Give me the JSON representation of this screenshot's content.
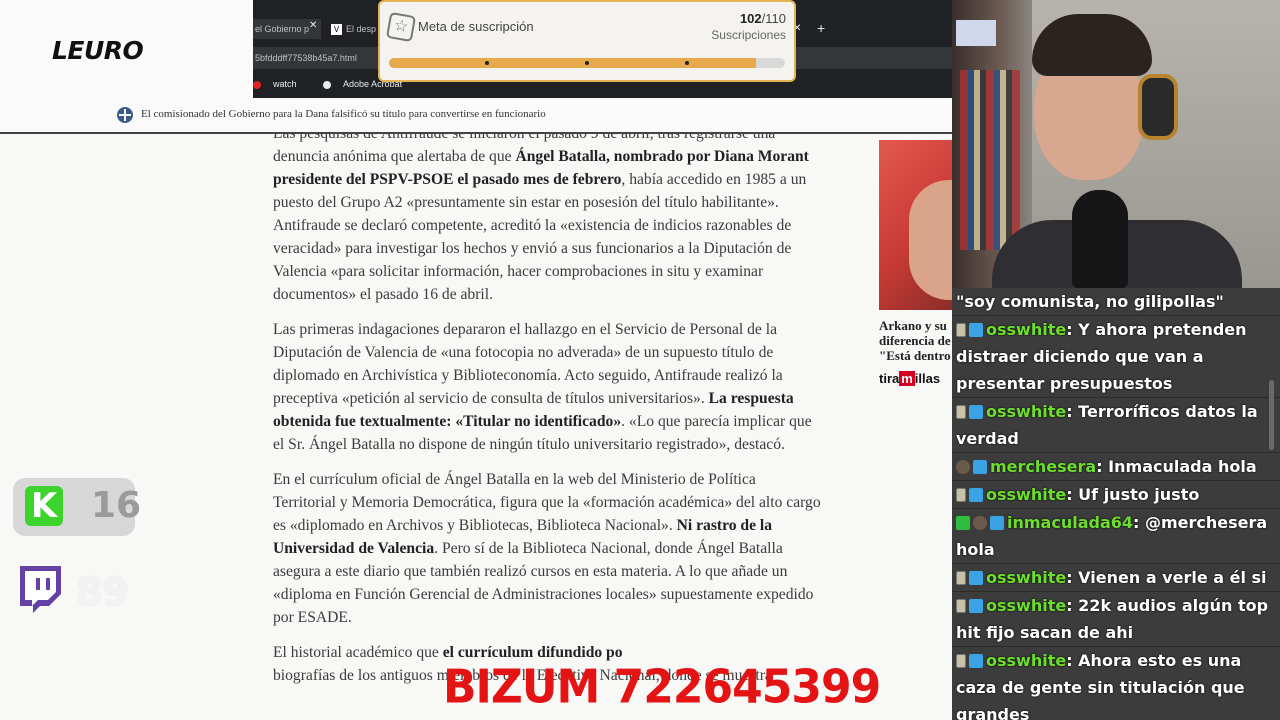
{
  "header": {
    "logo": "LEURO"
  },
  "browser": {
    "tabs": [
      {
        "label": "el Gobierno p"
      },
      {
        "label": "El desp",
        "favicon": "V"
      }
    ],
    "url": "5bfdddff77538b45a7.html",
    "bookmarks": [
      {
        "label": "watch",
        "icon": "youtube-icon"
      },
      {
        "label": "Adobe Acrobat",
        "icon": "acrobat-icon"
      }
    ]
  },
  "notice": {
    "text": "El comisionado del Gobierno para la Dana falsificó su título para convertirse en funcionario"
  },
  "subscription_goal": {
    "title": "Meta de suscripción",
    "current": "102",
    "target": "/110",
    "label": "Suscripciones",
    "progress_fraction": 0.9273
  },
  "article": {
    "p1_a": "Las pesquisas de Antifraude se iniciaron el pasado 9 de abril, tras registrarse una denuncia anónima que alertaba de que ",
    "p1_b": "Ángel Batalla, nombrado por Diana Morant presidente del PSPV-PSOE el pasado mes de febrero",
    "p1_c": ", había accedido en 1985 a un puesto del Grupo A2 «presuntamente sin estar en posesión del título habilitante». Antifraude se declaró competente, acreditó la «existencia de indicios razonables de veracidad» para investigar los hechos y envió a sus funcionarios a la Diputación de Valencia «para solicitar información, hacer comprobaciones in situ y examinar documentos» el pasado 16 de abril.",
    "p2_a": "Las primeras indagaciones depararon el hallazgo en el Servicio de Personal de la Diputación de Valencia de «una fotocopia no adverada» de un supuesto título de diplomado en Archivística y Biblioteconomía. Acto seguido, Antifraude realizó la preceptiva «petición al servicio de consulta de títulos universitarios». ",
    "p2_b": "La respuesta obtenida fue textualmente: «Titular no identificado»",
    "p2_c": ". «Lo que parecía implicar que el Sr. Ángel Batalla no dispone de ningún título universitario registrado», destacó.",
    "p3_a": "En el currículum oficial de Ángel Batalla en la web del Ministerio de Política Territorial y Memoria Democrática, figura que la «formación académica» del alto cargo es «diplomado en Archivos y Bibliotecas, Biblioteca Nacional». ",
    "p3_b": "Ni rastro de la Universidad de Valencia",
    "p3_c": ". Pero sí de la Biblioteca Nacional, donde Ángel Batalla asegura a este diario que también realizó cursos en esta materia. A lo que añade un «diploma en Función Gerencial de Administraciones locales» supuestamente expedido por ESADE.",
    "p4_a": "El historial académico que ",
    "p4_b": "el currículum difundido po",
    "p4_c": "biografías de los antiguos miembros de la Ejecutiva Nacional, donde se muestra"
  },
  "sidebar": {
    "caption_lines": [
      "Arkano y su",
      "diferencia de edad que hay entre ellos:",
      "\"Está dentro"
    ],
    "brand_a": "tira",
    "brand_b": "m",
    "brand_c": "illas"
  },
  "stream": {
    "kick_viewers": "16",
    "twitch_viewers": "89",
    "bizum": "BIZUM 722645399"
  },
  "chat": {
    "messages": [
      {
        "user": "",
        "text": "\"soy comunista, no gilipollas\"",
        "badges": []
      },
      {
        "user": "osswhite",
        "text": ": Y ahora pretenden distraer diciendo que van a presentar presupuestos",
        "badges": [
          "tier",
          "sub"
        ]
      },
      {
        "user": "osswhite",
        "text": ": Terroríficos datos la verdad",
        "badges": [
          "tier",
          "sub"
        ]
      },
      {
        "user": "merchesera",
        "text": ": Inmaculada hola",
        "badges": [
          "avatar",
          "sub"
        ]
      },
      {
        "user": "osswhite",
        "text": ": Uf justo justo",
        "badges": [
          "tier",
          "sub"
        ]
      },
      {
        "user": "inmaculada64",
        "text": ": @merchesera hola",
        "badges": [
          "mod",
          "avatar",
          "sub"
        ]
      },
      {
        "user": "osswhite",
        "text": ": Vienen a verle a él si",
        "badges": [
          "tier",
          "sub"
        ]
      },
      {
        "user": "osswhite",
        "text": ": 22k audios algún top hit fijo sacan de ahi",
        "badges": [
          "tier",
          "sub"
        ]
      },
      {
        "user": "osswhite",
        "text": ": Ahora esto es una caza de gente sin titulación que grandes",
        "badges": [
          "tier",
          "sub"
        ]
      }
    ]
  },
  "colors": {
    "goal_fill": "#e8a84c",
    "chat_username": "#6cde2b",
    "bizum_red": "#e41414",
    "kick_green": "#3cd32c",
    "twitch_purple": "#6441a5"
  }
}
